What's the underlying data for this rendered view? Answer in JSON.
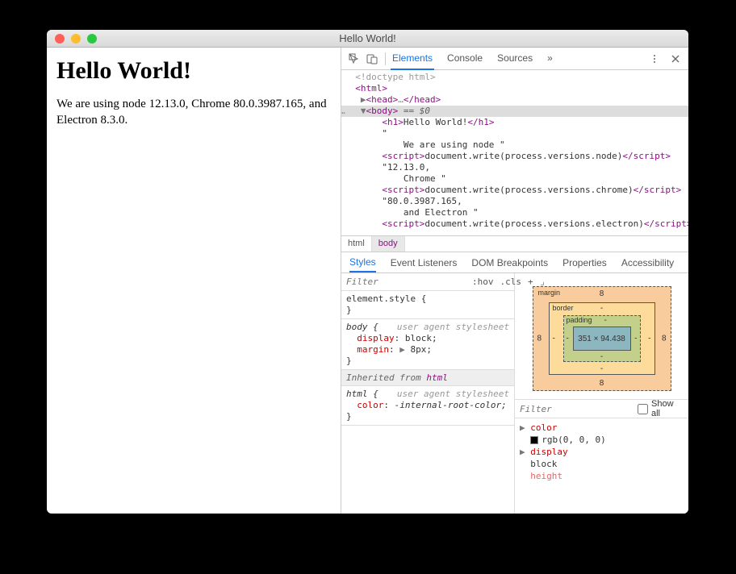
{
  "window": {
    "title": "Hello World!"
  },
  "page": {
    "heading": "Hello World!",
    "paragraph": "We are using node 12.13.0, Chrome 80.0.3987.165, and Electron 8.3.0."
  },
  "devtools": {
    "tabs": [
      "Elements",
      "Console",
      "Sources"
    ],
    "active_tab": "Elements",
    "more_glyph": "»",
    "elements_tree": {
      "doctype": "<!doctype html>",
      "html_open": "html",
      "head": {
        "open": "head",
        "ell": "…",
        "close": "head"
      },
      "body_open": "body",
      "body_suffix": " == $0",
      "h1": {
        "open": "h1",
        "text": "Hello World!",
        "close": "h1"
      },
      "q1": "\"",
      "txt_node": "    We are using node \"",
      "script1": {
        "open": "script",
        "text": "document.write(process.versions.node)",
        "close": "script"
      },
      "txt_12": "\"12.13.0,",
      "txt_chrome": "    Chrome \"",
      "script2": {
        "open": "script",
        "text": "document.write(process.versions.chrome)",
        "close": "script"
      },
      "txt_80": "\"80.0.3987.165,",
      "txt_electron": "    and Electron \"",
      "script3": {
        "open": "script",
        "text": "document.write(process.versions.electron)",
        "close": "script"
      }
    },
    "crumbs": [
      "html",
      "body"
    ],
    "subtabs": [
      "Styles",
      "Event Listeners",
      "DOM Breakpoints",
      "Properties",
      "Accessibility"
    ],
    "active_subtab": "Styles",
    "styles": {
      "filter_placeholder": "Filter",
      "hov": ":hov",
      "cls": ".cls",
      "blocks": [
        {
          "selector": "element.style {",
          "close": "}",
          "ua": "",
          "decls": []
        },
        {
          "selector": "body {",
          "ua": "user agent stylesheet",
          "decls": [
            {
              "prop": "display",
              "val": "block;"
            },
            {
              "prop": "margin",
              "val": "8px;",
              "expand": true
            }
          ],
          "close": "}"
        }
      ],
      "inherited_label": "Inherited from ",
      "inherited_from": "html",
      "inherited_block": {
        "selector": "html {",
        "ua": "user agent stylesheet",
        "decls": [
          {
            "prop": "color",
            "val": "-internal-root-color;"
          }
        ],
        "close": "}"
      }
    },
    "box_model": {
      "margin_label": "margin",
      "border_label": "border",
      "padding_label": "padding",
      "content": "351 × 94.438",
      "margin": {
        "top": "8",
        "right": "8",
        "bottom": "8",
        "left": "8"
      },
      "border": {
        "top": "-",
        "right": "-",
        "bottom": "-",
        "left": "-"
      },
      "padding": {
        "top": "-",
        "right": "-",
        "bottom": "-",
        "left": "-"
      }
    },
    "computed": {
      "filter_placeholder": "Filter",
      "show_all_label": "Show all",
      "rows": [
        {
          "prop": "color",
          "val": "rgb(0, 0, 0)",
          "swatch": true
        },
        {
          "prop": "display",
          "val": "block"
        },
        {
          "prop": "height",
          "val": ""
        }
      ]
    }
  }
}
